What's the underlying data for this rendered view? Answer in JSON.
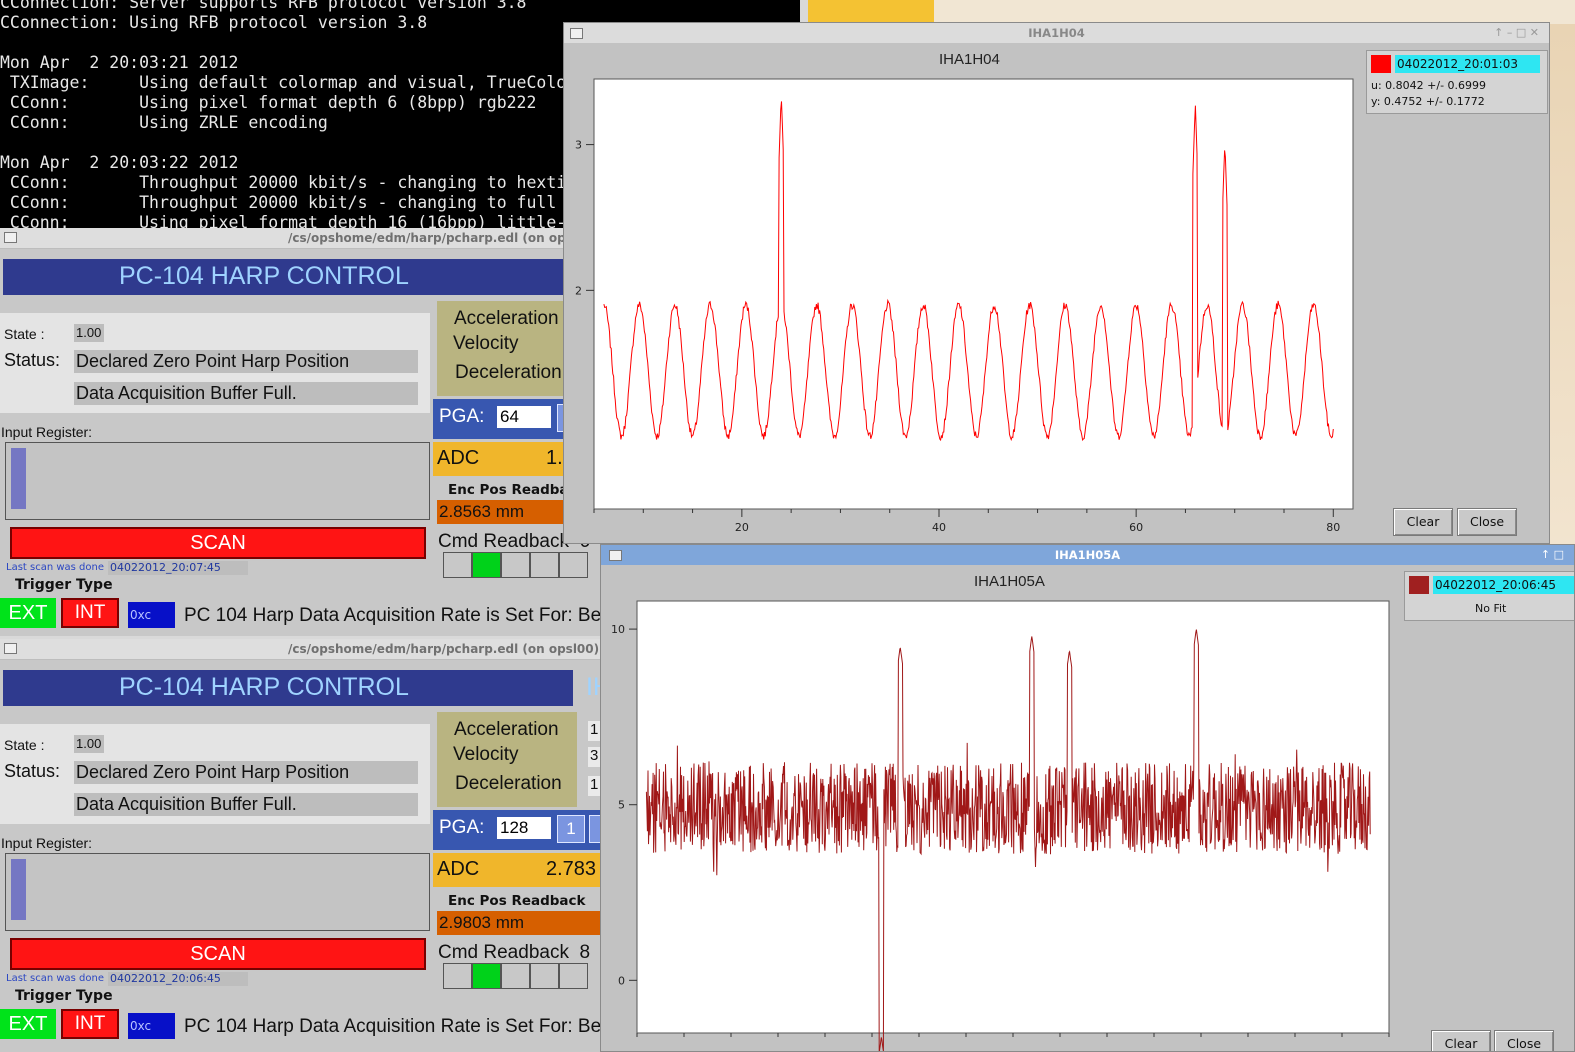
{
  "terminal": {
    "lines": [
      "CConnection: Server supports RFB protocol version 3.8",
      "CConnection: Using RFB protocol version 3.8",
      "",
      "Mon Apr  2 20:03:21 2012",
      " TXImage:     Using default colormap and visual, TrueColo",
      " CConn:       Using pixel format depth 6 (8bpp) rgb222",
      " CConn:       Using ZRLE encoding",
      "",
      "Mon Apr  2 20:03:22 2012",
      " CConn:       Throughput 20000 kbit/s - changing to hexti",
      " CConn:       Throughput 20000 kbit/s - changing to full",
      " CConn:       Using pixel format depth 16 (16bpp) little-"
    ]
  },
  "panel1": {
    "title": "/cs/opshome/edm/harp/pcharp.edl (on op",
    "banner": "PC-104 HARP CONTROL",
    "banner_right": "",
    "state_label": "State :",
    "state_value": "1.00",
    "status_label": "Status:",
    "status_value": "Declared Zero Point Harp Position",
    "status_value2": "Data Acquisition Buffer Full.",
    "accel_label": "Acceleration",
    "velocity_label": "Velocity",
    "decel_label": "Deceleration",
    "input_register_label": "Input Register:",
    "input_register_level": 0.9,
    "pga_label": "PGA:",
    "pga_value": "64",
    "adc_label": "ADC",
    "adc_value": "1.",
    "enc_label": "Enc Pos Readbac",
    "enc_value": "2.8563 mm",
    "scan_label": "SCAN",
    "last_scan_label": "Last scan was done",
    "last_scan_value": "04022012_20:07:45",
    "cmd_label": "Cmd Readback",
    "cmd_value": "6",
    "trigger_label": "Trigger Type",
    "ext_label": "EXT",
    "int_label": "INT",
    "hex_value": "0xc",
    "rate_text": "PC 104 Harp Data Acquisition Rate is Set For:  Bea",
    "active_cell": 1
  },
  "panel2": {
    "title": "/cs/opshome/edm/harp/pcharp.edl (on opsl00)",
    "banner": "PC-104 HARP CONTROL",
    "banner_right": "IH",
    "state_label": "State :",
    "state_value": "1.00",
    "status_label": "Status:",
    "status_value": "Declared Zero Point Harp Position",
    "status_value2": "Data Acquisition Buffer Full.",
    "accel_label": "Acceleration",
    "velocity_label": "Velocity",
    "decel_label": "Deceleration",
    "accel_value": "1",
    "velocity_value": "3",
    "decel_value": "1",
    "input_register_label": "Input Register:",
    "input_register_level": 0.9,
    "pga_label": "PGA:",
    "pga_value": "128",
    "pga_btn": "1",
    "adc_label": "ADC",
    "adc_value": "2.783",
    "enc_label": "Enc Pos Readback",
    "enc_value": "2.9803 mm",
    "scan_label": "SCAN",
    "last_scan_label": "Last scan was done",
    "last_scan_value": "04022012_20:06:45",
    "cmd_label": "Cmd Readback",
    "cmd_value": "8",
    "trigger_label": "Trigger Type",
    "ext_label": "EXT",
    "int_label": "INT",
    "hex_value": "0xc",
    "rate_text": "PC 104 Harp Data Acquisition Rate is Set For:  Bea",
    "active_cell": 1
  },
  "plot1": {
    "window_title": "IHA1H04",
    "plot_title": "IHA1H04",
    "legend_name": "04022012_20:01:03",
    "legend_color": "#ff0000",
    "fit_u": "u: 0.8042 +/- 0.6999",
    "fit_y": "y: 0.4752 +/- 0.1772",
    "clear_label": "Clear",
    "close_label": "Close",
    "line_color": "#ff0000"
  },
  "plot2": {
    "window_title": "IHA1H05A",
    "plot_title": "IHA1H05A",
    "legend_name": "04022012_20:06:45",
    "legend_color": "#a02020",
    "fit_text": "No Fit",
    "clear_label": "Clear",
    "close_label": "Close",
    "line_color": "#a01818"
  },
  "chart_data": [
    {
      "type": "line",
      "title": "IHA1H04",
      "xlabel": "",
      "ylabel": "",
      "xlim": [
        5,
        82
      ],
      "ylim": [
        0.5,
        3.45
      ],
      "xticks": [
        20,
        40,
        60,
        80
      ],
      "yticks": [
        2,
        3
      ],
      "peaks": [
        {
          "x": 24.0,
          "y": 3.35
        },
        {
          "x": 66.0,
          "y": 3.28
        },
        {
          "x": 69.0,
          "y": 3.02
        }
      ],
      "baseline": 1.45,
      "amplitude": 0.45,
      "period": 3.6,
      "series": [
        {
          "name": "04022012_20:01:03",
          "color": "#ff0000"
        }
      ]
    },
    {
      "type": "line",
      "title": "IHA1H05A",
      "xlabel": "",
      "ylabel": "",
      "xlim": [
        0,
        80
      ],
      "ylim": [
        -1.5,
        10.8
      ],
      "yticks": [
        0,
        5,
        10
      ],
      "peaks": [
        {
          "x": 28.0,
          "y": 9.5
        },
        {
          "x": 42.0,
          "y": 9.8
        },
        {
          "x": 46.0,
          "y": 9.4
        },
        {
          "x": 59.5,
          "y": 10.0
        },
        {
          "x": 26.0,
          "y": -1.6
        }
      ],
      "baseline": 4.9,
      "amplitude": 1.3,
      "series": [
        {
          "name": "04022012_20:06:45",
          "color": "#a01818"
        }
      ]
    }
  ]
}
